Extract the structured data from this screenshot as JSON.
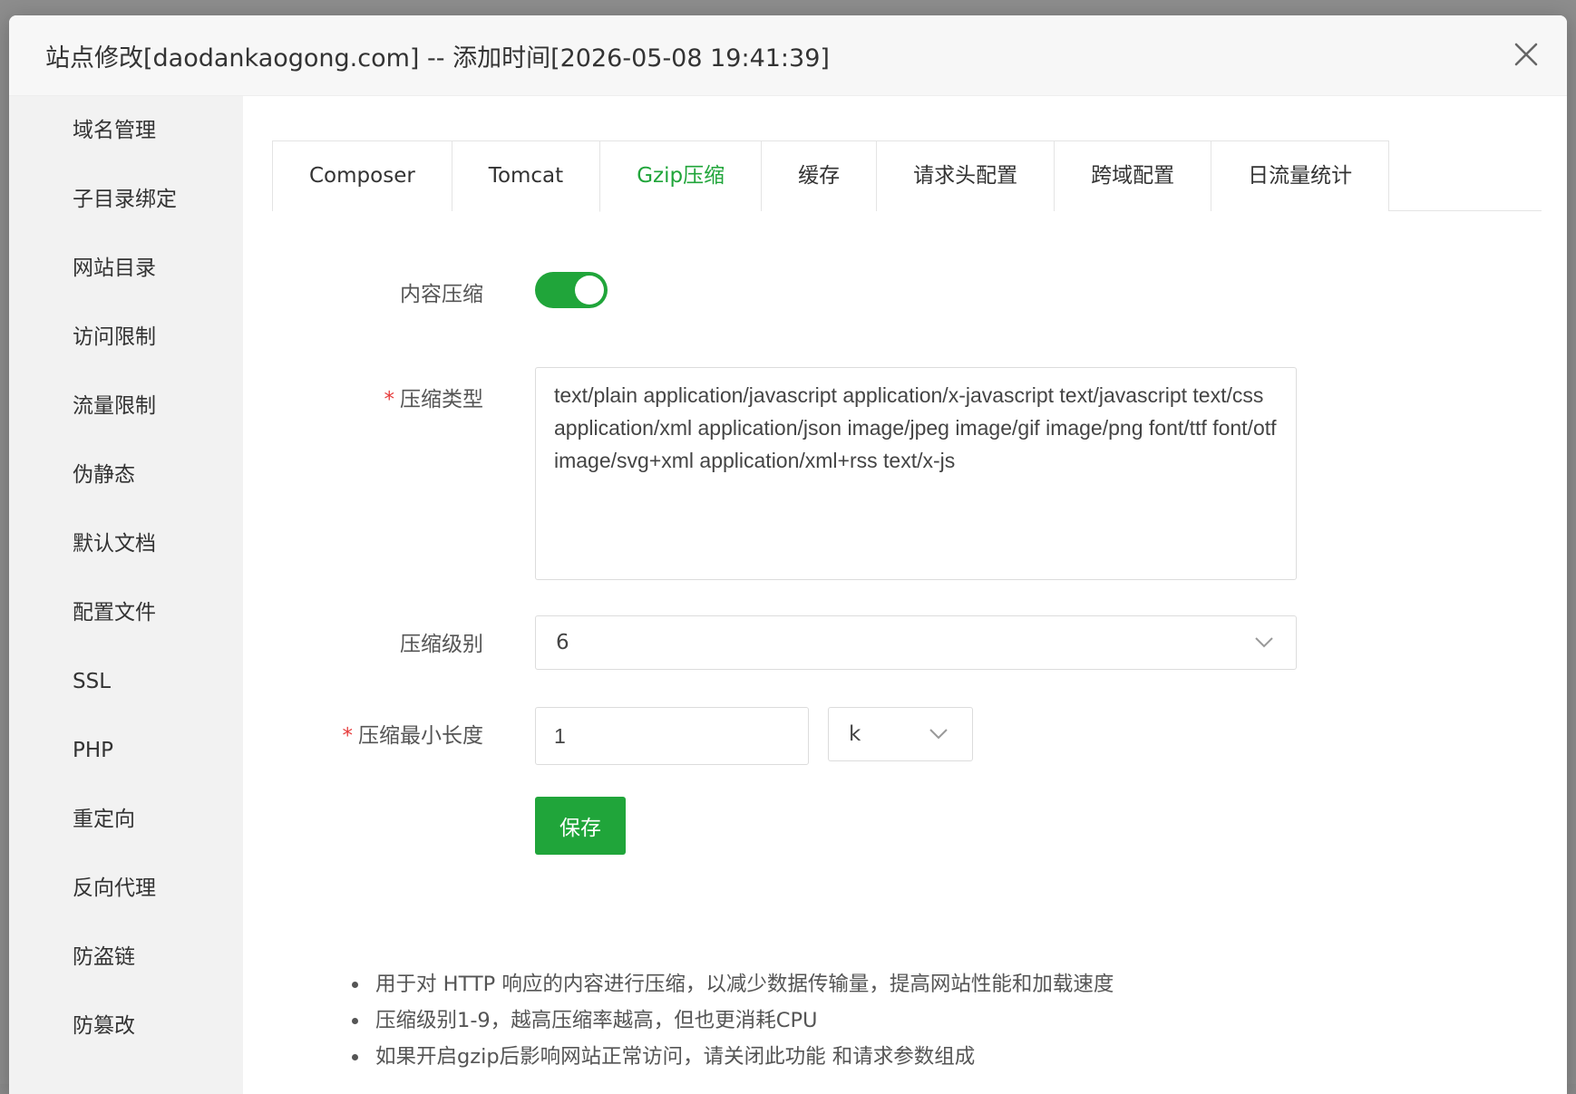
{
  "dialog": {
    "title": "站点修改[daodankaogong.com] -- 添加时间[2026-05-08 19:41:39]"
  },
  "sidebar": {
    "items": [
      {
        "label": "域名管理"
      },
      {
        "label": "子目录绑定"
      },
      {
        "label": "网站目录"
      },
      {
        "label": "访问限制"
      },
      {
        "label": "流量限制"
      },
      {
        "label": "伪静态"
      },
      {
        "label": "默认文档"
      },
      {
        "label": "配置文件"
      },
      {
        "label": "SSL"
      },
      {
        "label": "PHP"
      },
      {
        "label": "重定向"
      },
      {
        "label": "反向代理"
      },
      {
        "label": "防盗链"
      },
      {
        "label": "防篡改"
      }
    ]
  },
  "tabs": [
    {
      "label": "Composer"
    },
    {
      "label": "Tomcat"
    },
    {
      "label": "Gzip压缩",
      "active": true
    },
    {
      "label": "缓存"
    },
    {
      "label": "请求头配置"
    },
    {
      "label": "跨域配置"
    },
    {
      "label": "日流量统计"
    }
  ],
  "form": {
    "compress_label": "内容压缩",
    "compress_enabled": true,
    "types_label": "压缩类型",
    "types_value": "text/plain application/javascript application/x-javascript text/javascript text/css application/xml application/json image/jpeg image/gif image/png font/ttf font/otf image/svg+xml application/xml+rss text/x-js",
    "level_label": "压缩级别",
    "level_value": "6",
    "minlen_label": "压缩最小长度",
    "minlen_value": "1",
    "unit_value": "k",
    "required_mark": "*",
    "save_label": "保存"
  },
  "tips": [
    "用于对 HTTP 响应的内容进行压缩，以减少数据传输量，提高网站性能和加载速度",
    "压缩级别1-9，越高压缩率越高，但也更消耗CPU",
    "如果开启gzip后影响网站正常访问，请关闭此功能 和请求参数组成"
  ],
  "colors": {
    "accent": "#20a53a",
    "required": "#e63c3c"
  }
}
